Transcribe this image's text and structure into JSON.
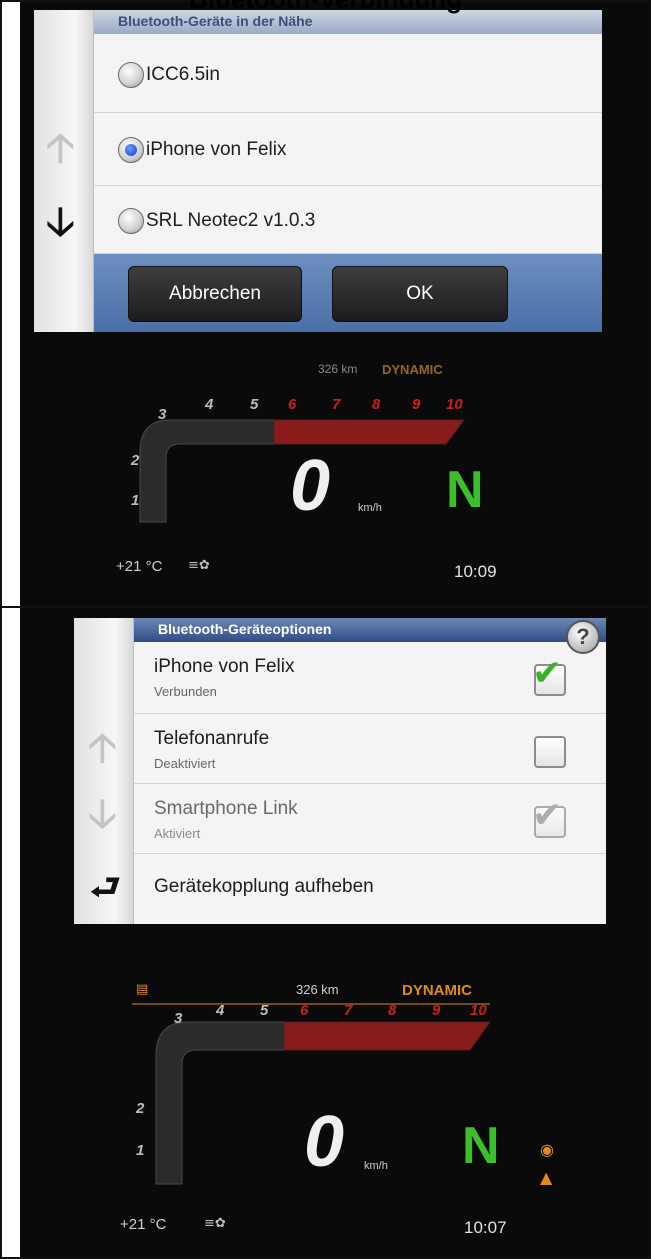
{
  "header": {
    "title": "Bluetooth-Verbindung"
  },
  "panel1": {
    "dialog_title": "Bluetooth-Geräte in der Nähe",
    "devices": [
      {
        "label": "ICC6.5in",
        "selected": false
      },
      {
        "label": "iPhone von Felix",
        "selected": true
      },
      {
        "label": "SRL Neotec2 v1.0.3",
        "selected": false
      }
    ],
    "cancel_label": "Abbrechen",
    "ok_label": "OK",
    "dashboard": {
      "range": "326 km",
      "mode": "DYNAMIC",
      "speed": "0",
      "speed_unit": "km/h",
      "gear": "N",
      "temperature": "+21 °C",
      "time": "10:09"
    }
  },
  "panel2": {
    "dialog_title": "Bluetooth-Geräteoptionen",
    "help_symbol": "?",
    "options": [
      {
        "title": "iPhone von Felix",
        "status": "Verbunden",
        "checked": true
      },
      {
        "title": "Telefonanrufe",
        "status": "Deaktiviert",
        "checked": false
      },
      {
        "title": "Smartphone Link",
        "status": "Aktiviert",
        "checked": true
      }
    ],
    "unpair_label": "Gerätekopplung aufheben",
    "dashboard": {
      "range": "326 km",
      "mode": "DYNAMIC",
      "speed": "0",
      "speed_unit": "km/h",
      "gear": "N",
      "temperature": "+21 °C",
      "time": "10:07"
    }
  },
  "tacho_scale": [
    "1",
    "2",
    "3",
    "4",
    "5",
    "6",
    "7",
    "8",
    "9",
    "10"
  ],
  "colors": {
    "title_bar": "#2f4c86",
    "button_bar": "#4a6ea6",
    "redline": "#c52121",
    "gear": "#3bbf2a",
    "dash_orange": "#e08a1e"
  }
}
